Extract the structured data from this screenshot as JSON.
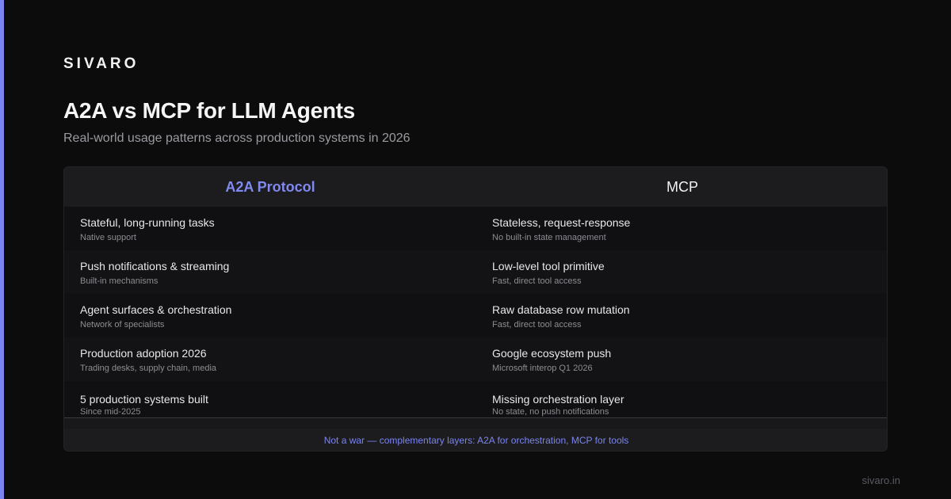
{
  "brand": "SIVARO",
  "title": "A2A vs MCP for LLM Agents",
  "subtitle": "Real-world usage patterns across production systems in 2026",
  "table": {
    "headers": [
      "A2A Protocol",
      "MCP"
    ],
    "rows": [
      {
        "a2a": {
          "main": "Stateful, long-running tasks",
          "sub": "Native support"
        },
        "mcp": {
          "main": "Stateless, request-response",
          "sub": "No built-in state management"
        }
      },
      {
        "a2a": {
          "main": "Push notifications & streaming",
          "sub": "Built-in mechanisms"
        },
        "mcp": {
          "main": "Low-level tool primitive",
          "sub": "Fast, direct tool access"
        }
      },
      {
        "a2a": {
          "main": "Agent surfaces & orchestration",
          "sub": "Network of specialists"
        },
        "mcp": {
          "main": "Raw database row mutation",
          "sub": "Fast, direct tool access"
        }
      },
      {
        "a2a": {
          "main": "Production adoption 2026",
          "sub": "Trading desks, supply chain, media"
        },
        "mcp": {
          "main": "Google ecosystem push",
          "sub": "Microsoft interop Q1 2026"
        }
      },
      {
        "a2a": {
          "main": "5 production systems built",
          "sub": "Since mid-2025"
        },
        "mcp": {
          "main": "Missing orchestration layer",
          "sub": "No state, no push notifications"
        }
      }
    ],
    "footer": "Not a war — complementary layers: A2A for orchestration, MCP for tools"
  },
  "url": "sivaro.in",
  "colors": {
    "accent": "#7b84f0",
    "background": "#0c0c0d"
  }
}
